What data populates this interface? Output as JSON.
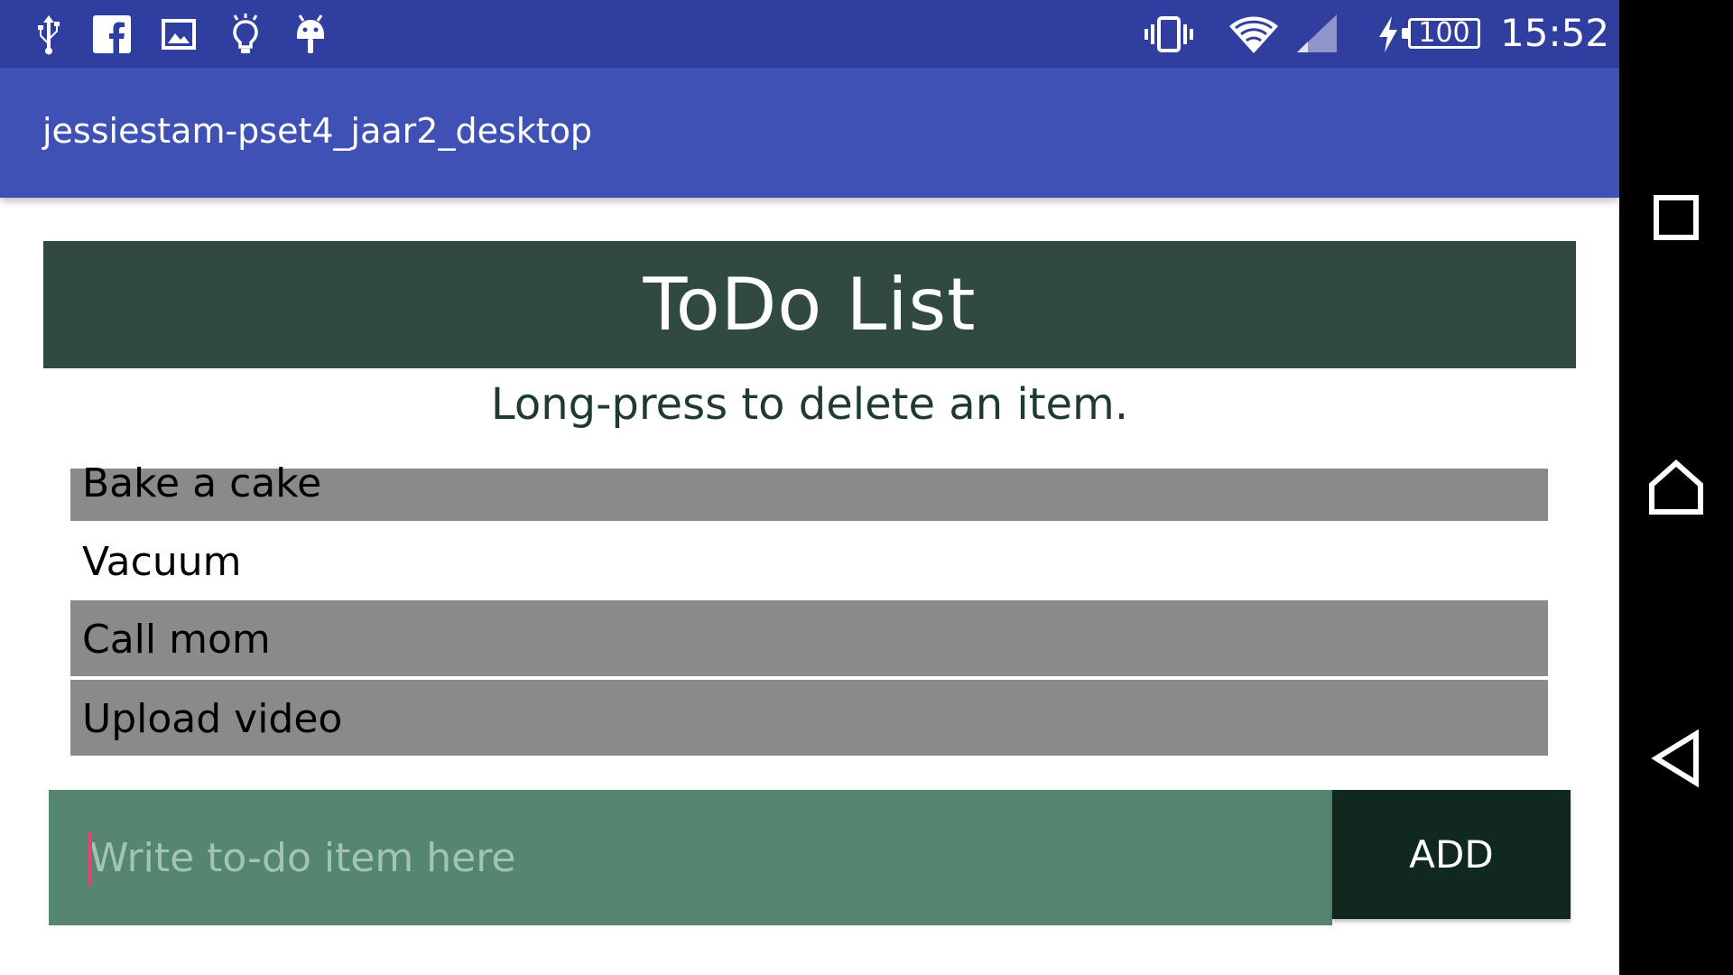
{
  "status_bar": {
    "icons": [
      "usb-icon",
      "facebook-icon",
      "image-icon",
      "lightbulb-icon",
      "android-icon",
      "vibrate-icon",
      "wifi-icon",
      "cell-signal-icon",
      "charging-icon"
    ],
    "battery_level": "100",
    "time": "15:52"
  },
  "toolbar": {
    "title": "jessiestam-pset4_jaar2_desktop"
  },
  "header": {
    "title": "ToDo List"
  },
  "instruction": "Long-press to delete an item.",
  "todo_items": [
    {
      "label": "Bake a cake",
      "highlighted": true
    },
    {
      "label": "Vacuum",
      "highlighted": false
    },
    {
      "label": "Call mom",
      "highlighted": true
    },
    {
      "label": "Upload video",
      "highlighted": true
    }
  ],
  "input": {
    "placeholder": "Write to-do item here",
    "value": ""
  },
  "add_button": {
    "label": "ADD"
  },
  "nav_bar": {
    "buttons": [
      "recent-apps-icon",
      "home-icon",
      "back-icon"
    ]
  },
  "colors": {
    "status_bar": "#303f9f",
    "toolbar": "#3f51b5",
    "header_banner": "#304a43",
    "highlighted_row": "#8a8a8a",
    "input_background": "#55866f",
    "add_button": "#102820"
  }
}
